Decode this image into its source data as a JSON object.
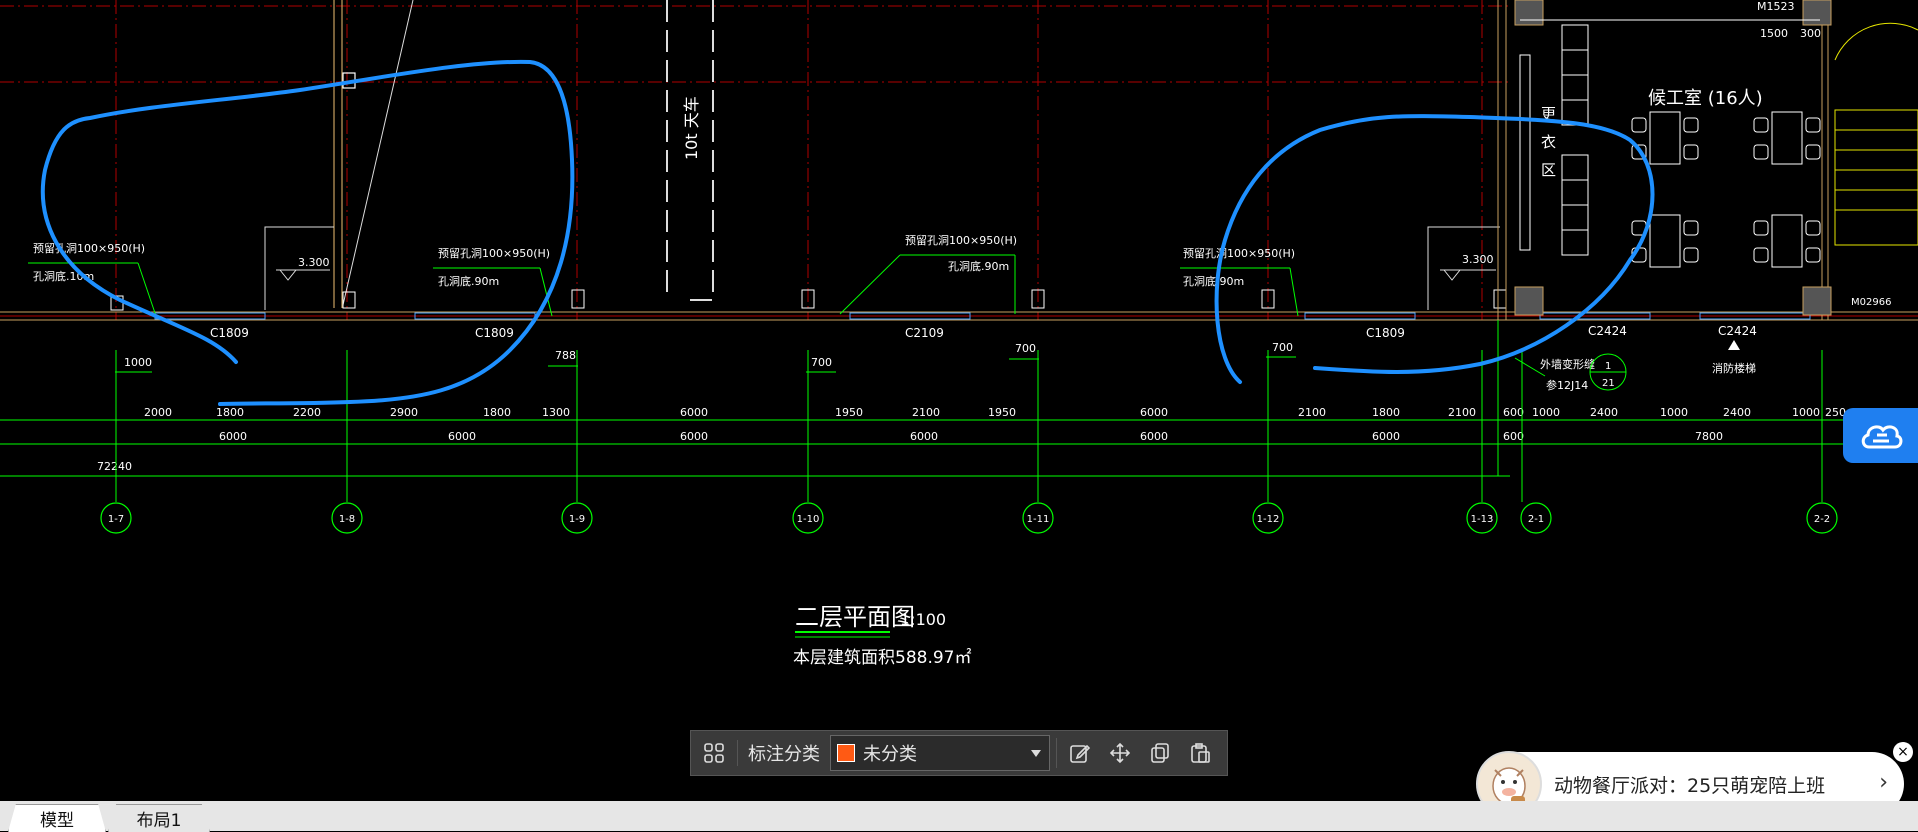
{
  "drawing": {
    "title": "二层平面图",
    "scale": "1:100",
    "area_note": "本层建筑面积588.97㎡",
    "window_labels": [
      "C1809",
      "C1809",
      "C2109",
      "C1809",
      "C2424",
      "C2424"
    ],
    "opening_notes": [
      {
        "line1": "预留孔洞100×950(H)",
        "line2": "孔洞底.10m"
      },
      {
        "line1": "预留孔洞100×950(H)",
        "line2": "孔洞底.90m"
      },
      {
        "line1": "预留孔洞100×950(H)",
        "line2": "孔洞底.90m"
      },
      {
        "line1": "预留孔洞100×950(H)",
        "line2": "孔洞底.90m"
      }
    ],
    "elevations": [
      "3.300",
      "3.300"
    ],
    "crane_label": "10t 天车",
    "room_label": "候工室 (16人)",
    "changing_area": [
      "更",
      "衣",
      "区"
    ],
    "door_label": "M1523",
    "door2_label": "M02966",
    "top_dims": [
      "1500",
      "300"
    ],
    "small_dims": [
      "1000",
      "788",
      "700",
      "700",
      "700"
    ],
    "dim_row1": [
      "2000",
      "1800",
      "2200",
      "2900",
      "1800",
      "1300",
      "6000",
      "1950",
      "2100",
      "1950",
      "6000",
      "2100",
      "1800",
      "2100",
      "600",
      "1000",
      "2400",
      "1000",
      "2400",
      "1000",
      "250"
    ],
    "dim_row2": [
      "6000",
      "6000",
      "6000",
      "6000",
      "6000",
      "6000",
      "600",
      "7800"
    ],
    "dim_total": "72240",
    "wall_note_1": "外墙变形缝",
    "wall_note_2": "参12J14",
    "detail_callout": {
      "top": "1",
      "bottom": "21"
    },
    "stair_note": "消防楼梯",
    "axis_labels": [
      "1-7",
      "1-8",
      "1-9",
      "1-10",
      "1-11",
      "1-12",
      "1-13",
      "2-1",
      "2-2"
    ]
  },
  "toolbar": {
    "label": "标注分类",
    "select_value": "未分类",
    "select_color": "#ff5a14",
    "icons": [
      "grid-icon",
      "edit-icon",
      "move-icon",
      "copy-icon",
      "paste-icon"
    ]
  },
  "tabs": [
    "模型",
    "布局1"
  ],
  "notification": {
    "text": "动物餐厅派对：25只萌宠陪上班",
    "close": "×",
    "arrow": "›"
  },
  "colors": {
    "background": "#000000",
    "axis": "#00ff00",
    "grid_red": "#cc0000",
    "markup": "#1e90ff",
    "wall": "#c8a060"
  }
}
